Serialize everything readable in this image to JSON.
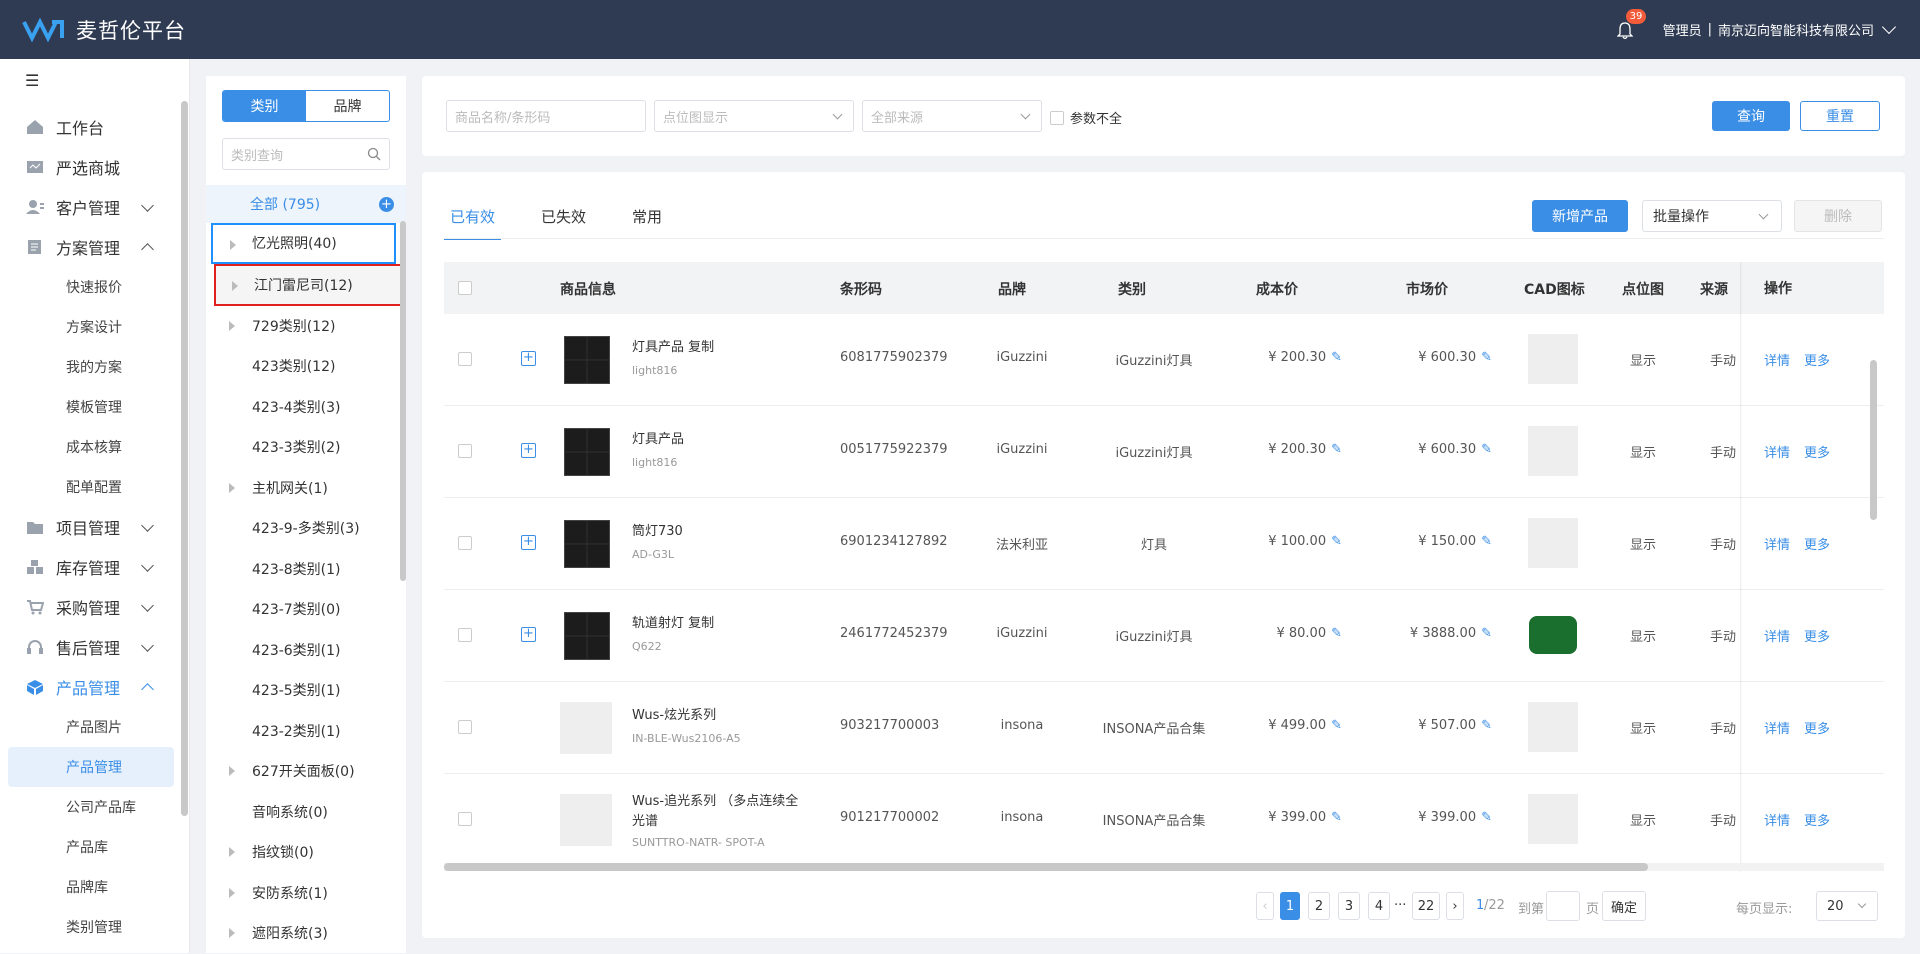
{
  "app": {
    "title": "麦哲伦平台",
    "notif_count": "39",
    "user": "管理员",
    "separator": "|",
    "company": "南京迈向智能科技有限公司"
  },
  "sidebar": {
    "collapse_icon": "☰",
    "items": [
      {
        "label": "工作台",
        "icon": "home-icon"
      },
      {
        "label": "严选商城",
        "icon": "shop-icon"
      },
      {
        "label": "客户管理",
        "icon": "customer-icon"
      },
      {
        "label": "方案管理",
        "icon": "plan-icon"
      },
      {
        "label": "项目管理",
        "icon": "folder-icon"
      },
      {
        "label": "库存管理",
        "icon": "inventory-icon"
      },
      {
        "label": "采购管理",
        "icon": "cart-icon"
      },
      {
        "label": "售后管理",
        "icon": "headset-icon"
      },
      {
        "label": "产品管理",
        "icon": "product-icon"
      }
    ],
    "plan_sub": [
      "快速报价",
      "方案设计",
      "我的方案",
      "模板管理",
      "成本核算",
      "配单配置"
    ],
    "product_sub": [
      "产品图片",
      "产品管理",
      "公司产品库",
      "产品库",
      "品牌库",
      "类别管理"
    ]
  },
  "catpanel": {
    "seg_category": "类别",
    "seg_brand": "品牌",
    "search_placeholder": "类别查询",
    "all": "全部 (795)",
    "items": [
      "忆光照明(40)",
      "江门雷尼司(12)",
      "729类别(12)",
      "423类别(12)",
      "423-4类别(3)",
      "423-3类别(2)",
      "主机网关(1)",
      "423-9-多类别(3)",
      "423-8类别(1)",
      "423-7类别(0)",
      "423-6类别(1)",
      "423-5类别(1)",
      "423-2类别(1)",
      "627开关面板(0)",
      "音响系统(0)",
      "指纹锁(0)",
      "安防系统(1)",
      "遮阳系统(3)"
    ]
  },
  "filter": {
    "name_placeholder": "商品名称/条形码",
    "point_placeholder": "点位图显示",
    "source_placeholder": "全部来源",
    "incomplete": "参数不全",
    "query": "查询",
    "reset": "重置"
  },
  "main": {
    "tabs": [
      "已有效",
      "已失效",
      "常用"
    ],
    "add": "新增产品",
    "bulk": "批量操作",
    "delete": "删除",
    "columns": [
      "商品信息",
      "条形码",
      "品牌",
      "类别",
      "成本价",
      "市场价",
      "CAD图标",
      "点位图",
      "来源",
      "操作"
    ],
    "rows": [
      {
        "name": "灯具产品 复制",
        "sku": "light816",
        "barcode": "6081775902379",
        "brand": "iGuzzini",
        "category": "iGuzzini灯具",
        "cost": "¥ 200.30",
        "market": "¥ 600.30",
        "point": "显示",
        "source": "手动",
        "detail": "详情",
        "more": "更多"
      },
      {
        "name": "灯具产品",
        "sku": "light816",
        "barcode": "0051775922379",
        "brand": "iGuzzini",
        "category": "iGuzzini灯具",
        "cost": "¥ 200.30",
        "market": "¥ 600.30",
        "point": "显示",
        "source": "手动",
        "detail": "详情",
        "more": "更多"
      },
      {
        "name": "筒灯730",
        "sku": "AD-G3L",
        "barcode": "6901234127892",
        "brand": "法米利亚",
        "category": "灯具",
        "cost": "¥ 100.00",
        "market": "¥ 150.00",
        "point": "显示",
        "source": "手动",
        "detail": "详情",
        "more": "更多"
      },
      {
        "name": "轨道射灯 复制",
        "sku": "Q622",
        "barcode": "2461772452379",
        "brand": "iGuzzini",
        "category": "iGuzzini灯具",
        "cost": "¥ 80.00",
        "market": "¥ 3888.00",
        "point": "显示",
        "source": "手动",
        "detail": "详情",
        "more": "更多"
      },
      {
        "name": "Wus-炫光系列",
        "sku": "IN-BLE-Wus2106-A5",
        "barcode": "903217700003",
        "brand": "insona",
        "category": "INSONA产品合集",
        "cost": "¥ 499.00",
        "market": "¥ 507.00",
        "point": "显示",
        "source": "手动",
        "detail": "详情",
        "more": "更多"
      },
      {
        "name": "Wus-追光系列 （多点连续全光谱",
        "sku": "SUNTTRO-NATR- SPOT-A",
        "barcode": "901217700002",
        "brand": "insona",
        "category": "INSONA产品合集",
        "cost": "¥ 399.00",
        "market": "¥ 399.00",
        "point": "显示",
        "source": "手动",
        "detail": "详情",
        "more": "更多"
      }
    ]
  },
  "pager": {
    "prev": "‹",
    "pages": [
      "1",
      "2",
      "3",
      "4"
    ],
    "ellipsis": "···",
    "last": "22",
    "next": "›",
    "current": "1",
    "total": "/22",
    "goto": "到第",
    "page_unit": "页",
    "confirm": "确定",
    "per_page_label": "每页显示:",
    "per_page": "20"
  },
  "colors": {
    "topbar": "#2f3b52",
    "accent": "#3a8ee6",
    "cad_green": "#1a6e2e"
  }
}
